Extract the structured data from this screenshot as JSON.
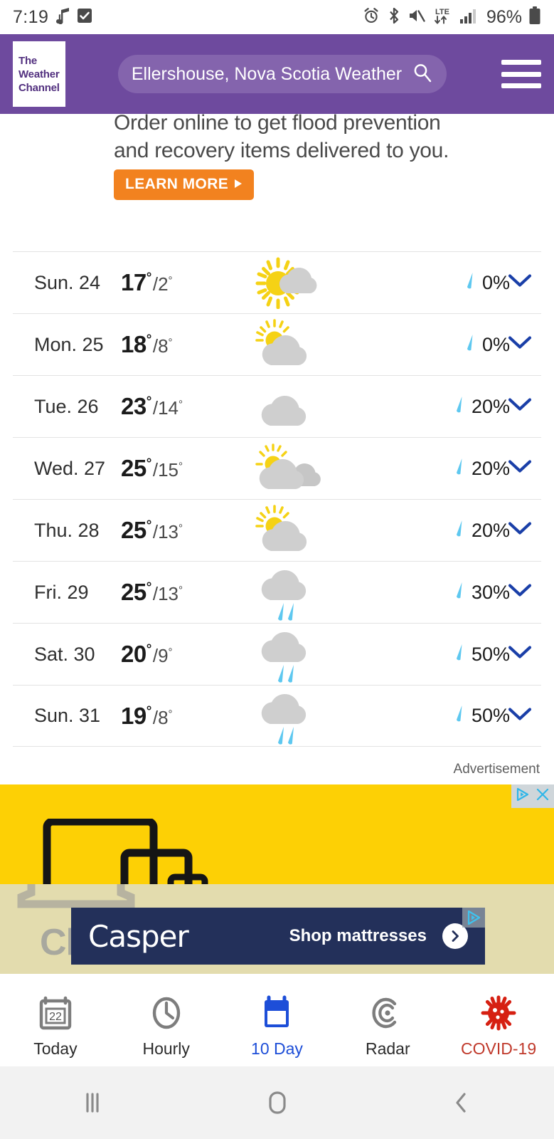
{
  "status_bar": {
    "time": "7:19",
    "battery_percent": "96%",
    "network": "LTE",
    "icons": [
      "music-note-icon",
      "checkbox-icon",
      "alarm-icon",
      "bluetooth-icon",
      "mute-icon",
      "lte-data-icon",
      "signal-bars-icon",
      "battery-icon"
    ]
  },
  "header": {
    "logo_line1": "The",
    "logo_line2": "Weather",
    "logo_line3": "Channel",
    "search_value": "Ellershouse, Nova Scotia Weather",
    "menu_label": "Menu"
  },
  "top_ad": {
    "line1": "Order online to get flood prevention",
    "line2": "and recovery items delivered to you.",
    "cta": "LEARN MORE",
    "cta_color": "#f2821f"
  },
  "forecast": {
    "rows": [
      {
        "day": "Sun. 24",
        "high": "17",
        "low": "2",
        "icon": "sun-behind-cloud-icon",
        "precip": "0%"
      },
      {
        "day": "Mon. 25",
        "high": "18",
        "low": "8",
        "icon": "sun-behind-large-cloud-icon",
        "precip": "0%"
      },
      {
        "day": "Tue. 26",
        "high": "23",
        "low": "14",
        "icon": "cloud-icon",
        "precip": "20%"
      },
      {
        "day": "Wed. 27",
        "high": "25",
        "low": "15",
        "icon": "sun-behind-two-clouds-icon",
        "precip": "20%"
      },
      {
        "day": "Thu. 28",
        "high": "25",
        "low": "13",
        "icon": "sun-behind-large-cloud-icon",
        "precip": "20%"
      },
      {
        "day": "Fri. 29",
        "high": "25",
        "low": "13",
        "icon": "rain-cloud-icon",
        "precip": "30%"
      },
      {
        "day": "Sat. 30",
        "high": "20",
        "low": "9",
        "icon": "rain-cloud-icon",
        "precip": "50%"
      },
      {
        "day": "Sun. 31",
        "high": "19",
        "low": "8",
        "icon": "rain-cloud-icon",
        "precip": "50%"
      }
    ],
    "degree": "°",
    "separator": "/",
    "expand_icon": "chevron-down-icon",
    "precip_icon": "raindrop-icon",
    "accent_blue": "#1a3fa8",
    "raindrop_color": "#5ec8f0"
  },
  "advertisement": {
    "label": "Advertisement",
    "background_color": "#fdd005",
    "secondary_color": "#e3dcae",
    "background_text": "Clearance items are",
    "adchoices_icon": "adchoices-icon",
    "close_icon": "close-icon",
    "banner": {
      "brand": "Casper",
      "cta": "Shop mattresses",
      "arrow_icon": "chevron-right-icon",
      "background_color": "#23305a"
    }
  },
  "bottom_nav": {
    "items": [
      {
        "label": "Today",
        "icon": "calendar-day-icon",
        "badge": "22",
        "active": false
      },
      {
        "label": "Hourly",
        "icon": "clock-icon",
        "badge": "",
        "active": false
      },
      {
        "label": "10 Day",
        "icon": "calendar-icon",
        "badge": "",
        "active": true
      },
      {
        "label": "Radar",
        "icon": "radar-icon",
        "badge": "",
        "active": false
      },
      {
        "label": "COVID-19",
        "icon": "virus-icon",
        "badge": "",
        "active": false
      }
    ],
    "active_color": "#1d4ed8",
    "covid_color": "#c0392b"
  },
  "system_nav": {
    "recents": "recents-icon",
    "home": "home-icon",
    "back": "back-icon"
  }
}
